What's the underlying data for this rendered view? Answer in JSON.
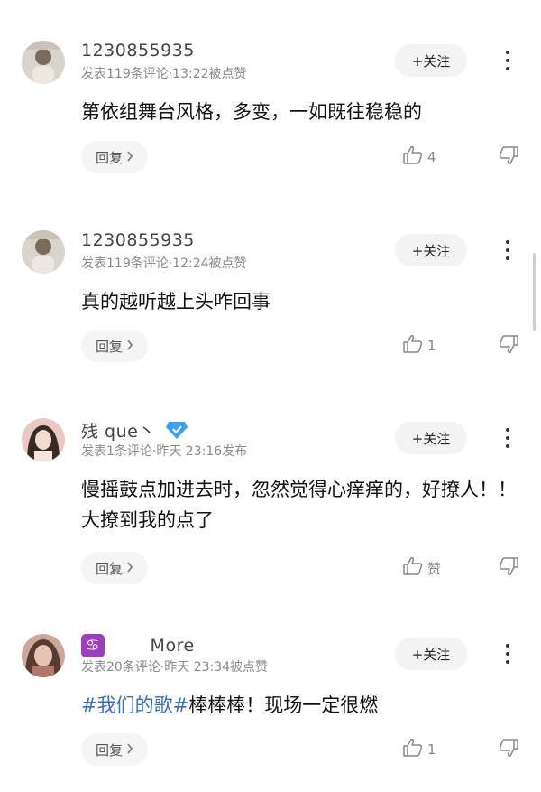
{
  "comments": [
    {
      "user": "1230855935",
      "meta": "发表119条评论·13:22被点赞",
      "follow_label": "+关注",
      "content_tag": "",
      "content": "第依组舞台风格，多变，一如既往稳稳的",
      "reply_label": "回复",
      "like_count": "4"
    },
    {
      "user": "1230855935",
      "meta": "发表119条评论·12:24被点赞",
      "follow_label": "+关注",
      "content_tag": "",
      "content": "真的越听越上头咋回事",
      "reply_label": "回复",
      "like_count": "1"
    },
    {
      "user": "残 que丶",
      "meta": "发表1条评论·昨天 23:16发布",
      "follow_label": "+关注",
      "content_tag": "",
      "content": "慢摇鼓点加进去时，忽然觉得心痒痒的，好撩人！！大撩到我的点了",
      "reply_label": "回复",
      "like_count": "赞"
    },
    {
      "user": "More",
      "zodiac_glyph": "♋",
      "meta": "发表20条评论·昨天 23:34被点赞",
      "follow_label": "+关注",
      "content_tag": "#我们的歌#",
      "content": "棒棒棒！现场一定很燃",
      "reply_label": "回复",
      "like_count": "1"
    }
  ],
  "icons": {
    "like": "thumbs-up-icon",
    "dislike": "thumbs-down-icon",
    "more": "more-vertical-icon",
    "reply_arrow": "chevron-right-icon",
    "vip": "diamond-badge-icon",
    "zodiac": "cancer-zodiac-icon"
  },
  "colors": {
    "tag": "#3a6fb8",
    "meta": "#8a8a8a",
    "button_bg": "#f3f3f3",
    "vip": "#3aa0f0",
    "zodiac": "#9b3fbf"
  }
}
